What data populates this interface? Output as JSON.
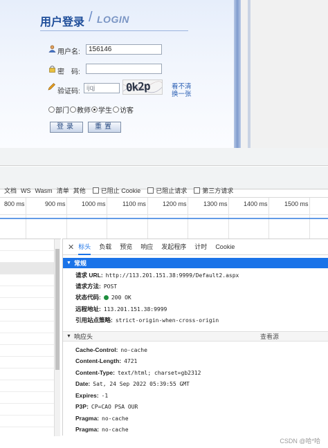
{
  "login": {
    "title_cn": "用户登录",
    "title_slash": "/",
    "title_en": "LOGIN",
    "username_label": "用户名:",
    "username_value": "156146",
    "password_label": "密　码:",
    "password_value": "",
    "captcha_label": "验证码:",
    "captcha_value": "ijqj",
    "captcha_image_text": "0k2p",
    "refresh_line1": "看不清",
    "refresh_line2": "换一张",
    "roles": [
      {
        "label": "部门",
        "checked": false
      },
      {
        "label": "教师",
        "checked": false
      },
      {
        "label": "学生",
        "checked": true
      },
      {
        "label": "访客",
        "checked": false
      }
    ],
    "login_button": "登录",
    "reset_button": "重置",
    "icons": {
      "username": "user-icon",
      "password": "lock-icon",
      "captcha": "pencil-icon"
    }
  },
  "devtools": {
    "filters": [
      "文档",
      "WS",
      "Wasm",
      "清单",
      "其他"
    ],
    "checkboxes": [
      "已阻止 Cookie",
      "已阻止请求",
      "第三方请求"
    ],
    "timeline_ticks": [
      "800 ms",
      "900 ms",
      "1000 ms",
      "1100 ms",
      "1200 ms",
      "1300 ms",
      "1400 ms",
      "1500 ms"
    ],
    "tabs": [
      "标头",
      "负载",
      "预览",
      "响应",
      "发起程序",
      "计时",
      "Cookie"
    ],
    "active_tab": "标头",
    "general": {
      "title": "常规",
      "rows": [
        {
          "key": "请求 URL:",
          "value": "http://113.201.151.38:9999/Default2.aspx"
        },
        {
          "key": "请求方法:",
          "value": "POST"
        },
        {
          "key": "状态代码:",
          "value": "200 OK"
        },
        {
          "key": "远程地址:",
          "value": "113.201.151.38:9999"
        },
        {
          "key": "引用站点策略:",
          "value": "strict-origin-when-cross-origin"
        }
      ]
    },
    "response_headers": {
      "title": "响应头",
      "view_source": "查看源",
      "rows": [
        {
          "key": "Cache-Control:",
          "value": "no-cache"
        },
        {
          "key": "Content-Length:",
          "value": "4721"
        },
        {
          "key": "Content-Type:",
          "value": "text/html; charset=gb2312"
        },
        {
          "key": "Date:",
          "value": "Sat, 24 Sep 2022 05:39:55 GMT"
        },
        {
          "key": "Expires:",
          "value": "-1"
        },
        {
          "key": "P3P:",
          "value": "CP=CAO PSA OUR"
        },
        {
          "key": "Pragma:",
          "value": "no-cache"
        },
        {
          "key": "Pragma:",
          "value": "no-cache"
        }
      ]
    },
    "status_color": "#1e8e3e",
    "accent": "#1a73e8"
  },
  "watermark": "CSDN @哈*哈"
}
